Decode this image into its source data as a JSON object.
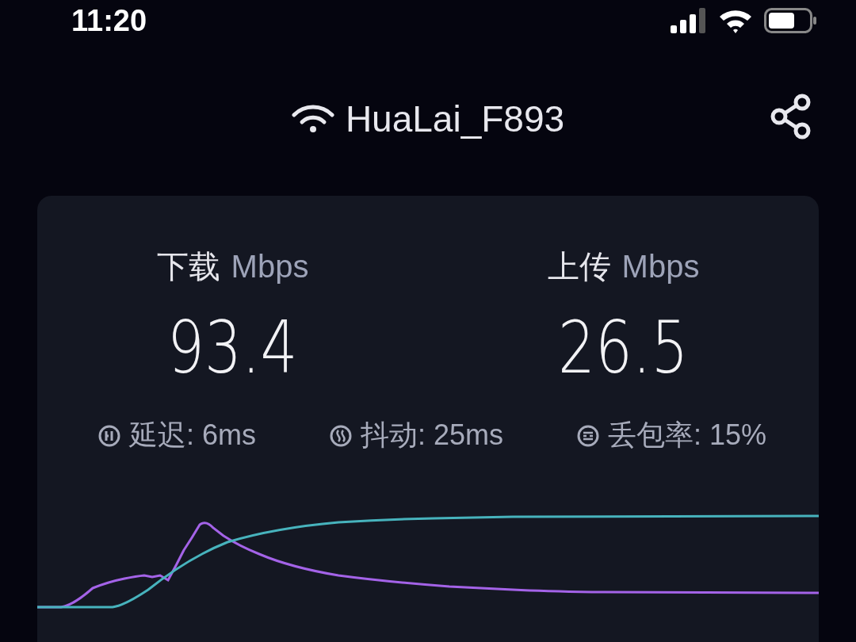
{
  "status_bar": {
    "time": "11:20"
  },
  "header": {
    "network_name": "HuaLai_F893"
  },
  "results": [
    {
      "label": "下载",
      "unit": "Mbps",
      "value": "93.4"
    },
    {
      "label": "上传",
      "unit": "Mbps",
      "value": "26.5"
    }
  ],
  "metrics": [
    {
      "kind": "latency",
      "text": "延迟: 6ms"
    },
    {
      "kind": "jitter",
      "text": "抖动: 25ms"
    },
    {
      "kind": "loss",
      "text": "丢包率: 15%"
    }
  ]
}
